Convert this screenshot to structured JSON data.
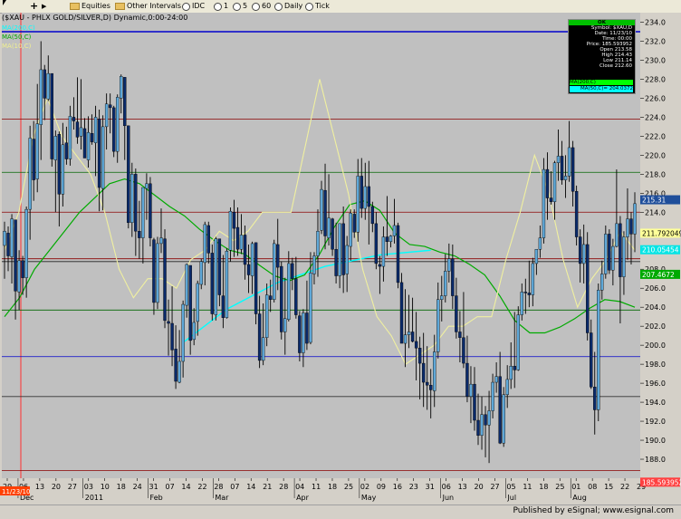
{
  "toolbar": {
    "items": [
      {
        "icon": "folder-icon",
        "label": "Equities"
      },
      {
        "icon": "folder-icon",
        "label": "Other Intervals"
      },
      {
        "icon": "gear-icon",
        "label": "IDC"
      },
      {
        "label": "1"
      },
      {
        "label": "5"
      },
      {
        "label": "60"
      },
      {
        "label": "Daily"
      },
      {
        "label": "Tick"
      }
    ]
  },
  "footer": {
    "published_text": "Published by eSignal; www.esignal.com"
  },
  "info_box": {
    "status": "OK",
    "rows": [
      "Symbol: $XAU,D",
      "Date: 11/23/10",
      "Time: 00:00",
      "Price: 185.593952",
      "Open 213.58",
      "High 214.43",
      "Low 211.14",
      "Close 212.60"
    ],
    "ma1": "MA(200,C)",
    "ma2": "MA(50,C)= 204.0372"
  },
  "chart_data": {
    "type": "candlestick",
    "title": "($XAU - PHLX GOLD/SILVER,D) Dynamic,0:00-24:00",
    "ylim": [
      186.0,
      235.0
    ],
    "y_ticks": [
      188,
      190,
      192,
      194,
      196,
      198,
      200,
      202,
      204,
      206,
      208,
      210,
      212,
      214,
      216,
      218,
      220,
      222,
      224,
      226,
      228,
      230,
      232,
      234
    ],
    "x_ticks": [
      "29",
      "06",
      "13",
      "20",
      "27",
      "03",
      "10",
      "18",
      "24",
      "31",
      "07",
      "14",
      "22",
      "28",
      "07",
      "14",
      "21",
      "28",
      "04",
      "11",
      "18",
      "25",
      "02",
      "09",
      "16",
      "23",
      "31",
      "06",
      "13",
      "20",
      "27",
      "05",
      "11",
      "18",
      "25",
      "01",
      "08",
      "15",
      "22",
      "29"
    ],
    "month_labels": [
      "Dec",
      "2011",
      "Feb",
      "Mar",
      "Apr",
      "May",
      "Jun",
      "Jul",
      "Aug"
    ],
    "legend": [
      {
        "label": "MA(200,C)",
        "color": "#00ffff"
      },
      {
        "label": "MA(50,C)",
        "color": "#00aa00"
      },
      {
        "label": "MA(10,C)",
        "color": "#ffff99"
      }
    ],
    "price_tags": [
      {
        "value": 215.31,
        "label": "215.31",
        "bg": "#1f4e9a",
        "fg": "#ffffff"
      },
      {
        "value": 211.79,
        "label": "211.792049",
        "bg": "#ffff99",
        "fg": "#000000"
      },
      {
        "value": 210.05,
        "label": "210.05454",
        "bg": "#00e5e5",
        "fg": "#ffffff"
      },
      {
        "value": 207.46,
        "label": "207.4672",
        "bg": "#00aa00",
        "fg": "#ffffff"
      },
      {
        "value": 185.59,
        "label": "185.593952",
        "bg": "#ff4040",
        "fg": "#ffffff"
      }
    ],
    "bottom_left_tag": "11/23/10",
    "horizontal_lines": [
      {
        "value": 233.0,
        "color": "#0000cc",
        "lineWidth": 1.5
      },
      {
        "value": 223.8,
        "color": "#8b0000"
      },
      {
        "value": 218.2,
        "color": "#006600"
      },
      {
        "value": 214.0,
        "color": "#8b0000"
      },
      {
        "value": 209.1,
        "color": "#8b0000"
      },
      {
        "value": 208.8,
        "color": "#222222"
      },
      {
        "value": 203.7,
        "color": "#006600"
      },
      {
        "value": 198.8,
        "color": "#0000cc"
      },
      {
        "value": 194.6,
        "color": "#333333"
      },
      {
        "value": 186.8,
        "color": "#8b0000"
      }
    ],
    "ma50": [
      203,
      205,
      208,
      210,
      212,
      214,
      215.5,
      217,
      217.5,
      217,
      215.8,
      214.6,
      213.6,
      212.2,
      211,
      210,
      209.6,
      208.4,
      207.3,
      206.8,
      207.4,
      209.6,
      212.5,
      214.8,
      215.2,
      214.2,
      211.8,
      210.6,
      210.4,
      209.8,
      209.4,
      208.5,
      207.4,
      205.2,
      202.6,
      201.3,
      201.3,
      201.9,
      202.8,
      203.9,
      204.8,
      204.6,
      204.0
    ],
    "ma10": [
      210,
      214,
      222,
      226,
      222,
      220,
      218,
      214,
      208,
      205,
      207,
      207,
      206,
      209,
      210,
      212,
      211,
      212,
      214,
      214,
      214,
      221,
      228,
      222,
      216,
      208,
      203,
      201,
      198,
      199,
      200,
      202,
      202,
      203,
      203,
      209,
      214,
      220,
      216,
      209,
      204,
      207,
      209,
      212,
      210
    ],
    "ma200": [
      [
        48.7,
        200.2
      ],
      [
        61,
        203.8
      ],
      [
        75,
        206.6
      ],
      [
        88,
        208.3
      ],
      [
        103,
        209.5
      ],
      [
        117,
        210.0
      ]
    ],
    "candles": [
      [
        210.5,
        213,
        207,
        212
      ],
      [
        211.8,
        212.5,
        207.8,
        209.4
      ],
      [
        209.3,
        213.8,
        206.5,
        213.3
      ],
      [
        213.2,
        213.2,
        202.7,
        205.7
      ],
      [
        205.6,
        210,
        203.7,
        208.9
      ],
      [
        208.9,
        209.4,
        205.3,
        207.1
      ],
      [
        207.1,
        214.6,
        205,
        214.3
      ],
      [
        214.3,
        223.1,
        211.1,
        221.8
      ],
      [
        221.7,
        223.6,
        215.2,
        217.4
      ],
      [
        217.5,
        227.5,
        216.1,
        223.3
      ],
      [
        223.2,
        232,
        219.5,
        229
      ],
      [
        229,
        229.5,
        223.7,
        226
      ],
      [
        225.9,
        230.5,
        225.7,
        228.6
      ],
      [
        228.6,
        228.6,
        218.8,
        219.6
      ],
      [
        219.5,
        222.6,
        214,
        222
      ],
      [
        222.2,
        222.5,
        212.5,
        215.9
      ],
      [
        215.9,
        223.4,
        214.6,
        221.1
      ],
      [
        221.3,
        223,
        219,
        219.6
      ],
      [
        219.6,
        225.2,
        218.9,
        224.1
      ],
      [
        224,
        226.1,
        222.7,
        223.6
      ],
      [
        223.5,
        228.2,
        221.2,
        221.9
      ],
      [
        222,
        228,
        220.6,
        222.9
      ],
      [
        222.8,
        223.9,
        219.7,
        219.7
      ],
      [
        219.5,
        224.1,
        218.7,
        222.4
      ],
      [
        222.3,
        224.3,
        221.1,
        221.4
      ],
      [
        221.3,
        225.2,
        217.8,
        224
      ],
      [
        223.8,
        224.8,
        214.1,
        216.6
      ],
      [
        216.5,
        224.2,
        214.2,
        223
      ],
      [
        223,
        226.5,
        220.6,
        225.4
      ],
      [
        225.3,
        226.5,
        222.3,
        225
      ],
      [
        225,
        225.2,
        219.8,
        220.4
      ],
      [
        220.4,
        226.4,
        219.2,
        226.1
      ],
      [
        226,
        228.5,
        224.4,
        228.3
      ],
      [
        228.2,
        228.2,
        219.5,
        223.1
      ],
      [
        223.1,
        223.1,
        212.3,
        212.9
      ],
      [
        212.9,
        219.2,
        211.4,
        218
      ],
      [
        218,
        218.6,
        209.4,
        212
      ],
      [
        212,
        215.2,
        209.1,
        211.3
      ],
      [
        211.3,
        216.6,
        208.6,
        216.6
      ],
      [
        216.5,
        218.1,
        213.2,
        217
      ],
      [
        217,
        217.7,
        210.4,
        211.3
      ],
      [
        211.1,
        211.3,
        203.2,
        204.5
      ],
      [
        204.5,
        211.4,
        203.8,
        210.7
      ],
      [
        210.7,
        214.4,
        209.7,
        211.3
      ],
      [
        211.2,
        212.2,
        201.8,
        202.6
      ],
      [
        202.5,
        204.8,
        198.9,
        202.3
      ],
      [
        202.3,
        206.2,
        197.8,
        199.5
      ],
      [
        199.6,
        202.1,
        195.4,
        196.2
      ],
      [
        196.1,
        201.6,
        196,
        198.3
      ],
      [
        198.3,
        204.7,
        196.6,
        204.3
      ],
      [
        204.2,
        208.6,
        202.9,
        208.5
      ],
      [
        208.4,
        208.4,
        199,
        200.5
      ],
      [
        200.6,
        203.9,
        200,
        202.4
      ],
      [
        202.5,
        206.8,
        201,
        206.5
      ],
      [
        206.4,
        209.1,
        205.9,
        208.8
      ],
      [
        208.7,
        213,
        206.3,
        212.7
      ],
      [
        212.6,
        213,
        208.6,
        209.7
      ],
      [
        209.7,
        210.6,
        202.6,
        203.3
      ],
      [
        203.2,
        211.4,
        202.6,
        211.2
      ],
      [
        211.2,
        211.2,
        204.1,
        205.3
      ],
      [
        205.2,
        209.5,
        201.8,
        202.9
      ],
      [
        202.9,
        210.2,
        202.8,
        209.9
      ],
      [
        210,
        214.5,
        208.8,
        214.1
      ],
      [
        214,
        215.3,
        209.3,
        212.3
      ],
      [
        212.4,
        214.5,
        209.4,
        210.1
      ],
      [
        210.1,
        213.8,
        209.6,
        211.6
      ],
      [
        211.6,
        212.6,
        206.9,
        208.5
      ],
      [
        208.5,
        210.6,
        205.5,
        207.4
      ],
      [
        207.3,
        210.9,
        205.4,
        210.7
      ],
      [
        210.8,
        210.8,
        202.2,
        203.3
      ],
      [
        203.3,
        205.2,
        197.6,
        198.4
      ],
      [
        198.4,
        204.4,
        197.9,
        200.8
      ],
      [
        200.8,
        206.5,
        199.9,
        205.3
      ],
      [
        205.2,
        206.9,
        203.5,
        204.8
      ],
      [
        204.8,
        211.1,
        204.5,
        210.7
      ],
      [
        210.6,
        213.3,
        205.8,
        208.2
      ],
      [
        208.3,
        208.8,
        200.6,
        201.4
      ],
      [
        201.4,
        207.1,
        199,
        202.8
      ],
      [
        202.7,
        209.9,
        202.5,
        208.6
      ],
      [
        208.6,
        209.2,
        205.8,
        207
      ],
      [
        207,
        209.3,
        202.8,
        203.2
      ],
      [
        203.1,
        203.6,
        198.3,
        199.2
      ],
      [
        199.2,
        203.8,
        197.7,
        203.4
      ],
      [
        203.4,
        206.8,
        199.5,
        200.2
      ],
      [
        200.3,
        209.8,
        200.1,
        207.6
      ],
      [
        207.5,
        209.8,
        206.4,
        209.4
      ],
      [
        209.4,
        214.3,
        207.2,
        212
      ],
      [
        212.1,
        217.3,
        211.7,
        216.4
      ],
      [
        216.3,
        219.1,
        210.1,
        211.5
      ],
      [
        211.3,
        218,
        210.5,
        213.4
      ],
      [
        213.3,
        213.4,
        209.4,
        210.1
      ],
      [
        210.1,
        212.9,
        206.5,
        207.3
      ],
      [
        207.3,
        212.8,
        206,
        212.8
      ],
      [
        212.8,
        214.6,
        205.5,
        207.4
      ],
      [
        207.5,
        211.5,
        205.6,
        210.5
      ],
      [
        210.4,
        214.3,
        208.9,
        213.9
      ],
      [
        213.8,
        214.3,
        211.3,
        211.9
      ],
      [
        211.9,
        219.6,
        210.9,
        217.8
      ],
      [
        217.8,
        219.7,
        213.4,
        214.4
      ],
      [
        214.4,
        219.2,
        213.2,
        216.7
      ],
      [
        216.7,
        219.4,
        210.6,
        214.6
      ],
      [
        214.6,
        215.1,
        211.9,
        212.8
      ],
      [
        212.8,
        214,
        208,
        208.6
      ],
      [
        208.5,
        209.4,
        205.4,
        208.3
      ],
      [
        208.3,
        212.5,
        206.7,
        211.4
      ],
      [
        211.4,
        215.7,
        209.4,
        210.9
      ],
      [
        210.9,
        211.6,
        210.3,
        211.5
      ],
      [
        211.5,
        215.4,
        210.7,
        212.6
      ],
      [
        212.6,
        212.9,
        206,
        206.6
      ],
      [
        206.6,
        207.6,
        200.2,
        200.2
      ],
      [
        200.2,
        205.9,
        197.7,
        201.1
      ],
      [
        201.1,
        205.3,
        199.7,
        201.4
      ],
      [
        201.4,
        205,
        200.3,
        200.4
      ],
      [
        200.4,
        203.5,
        196.3,
        199.7
      ],
      [
        199.7,
        200.9,
        194.3,
        198.1
      ],
      [
        198.1,
        201.3,
        193.5,
        196.1
      ],
      [
        196.1,
        199.9,
        193.2,
        195.8
      ],
      [
        195.8,
        197.5,
        192.3,
        195.3
      ],
      [
        195.2,
        201.1,
        193.5,
        199.3
      ],
      [
        199.3,
        206.6,
        198.6,
        204.8
      ],
      [
        204.8,
        207.3,
        202.5,
        205.2
      ],
      [
        205.2,
        209.6,
        204.5,
        207.8
      ],
      [
        207.8,
        210.7,
        206.6,
        209.1
      ],
      [
        209.1,
        210.6,
        203.8,
        205.2
      ],
      [
        205.2,
        207.1,
        200.7,
        201.4
      ],
      [
        201.4,
        203.6,
        198.2,
        200.8
      ],
      [
        200.8,
        205.6,
        197.6,
        198.1
      ],
      [
        198.1,
        201,
        194,
        194.6
      ],
      [
        194.6,
        197.8,
        191.8,
        195.9
      ],
      [
        195.9,
        197.7,
        191,
        192.1
      ],
      [
        192.1,
        194.9,
        189.5,
        190.5
      ],
      [
        190.5,
        194.6,
        189,
        192.7
      ],
      [
        192.7,
        193.6,
        188.2,
        191.6
      ],
      [
        191.6,
        195.2,
        187.6,
        193.1
      ],
      [
        193.1,
        197,
        192.3,
        196.1
      ],
      [
        196.1,
        198.2,
        195,
        196.7
      ],
      [
        196.7,
        199.3,
        189.6,
        189.7
      ],
      [
        189.7,
        195.6,
        189.3,
        194.8
      ],
      [
        194.8,
        197.9,
        193.4,
        196.4
      ],
      [
        196.4,
        200.3,
        195.4,
        197.8
      ],
      [
        197.8,
        203.5,
        195.5,
        197.4
      ],
      [
        197.4,
        204.1,
        197.3,
        203.2
      ],
      [
        203.2,
        206.5,
        202.6,
        205.6
      ],
      [
        205.6,
        207,
        203.3,
        205.5
      ],
      [
        205.5,
        208.9,
        204,
        205.3
      ],
      [
        205.3,
        209.2,
        204.1,
        208.6
      ],
      [
        208.6,
        210.1,
        207.4,
        210.1
      ],
      [
        210.1,
        212.6,
        209.2,
        211.3
      ],
      [
        211.3,
        219.7,
        210.7,
        218.5
      ],
      [
        218.5,
        220.3,
        213.2,
        215.5
      ],
      [
        215.5,
        218.3,
        214.8,
        215.1
      ],
      [
        215.1,
        219.4,
        213.2,
        219.2
      ],
      [
        219.2,
        222.7,
        217.3,
        219.9
      ],
      [
        219.9,
        221.5,
        216.9,
        217.4
      ],
      [
        217.4,
        220,
        215.5,
        217.8
      ],
      [
        217.8,
        223.6,
        217.2,
        220.8
      ],
      [
        220.8,
        221.5,
        214.6,
        216.2
      ],
      [
        216.2,
        216.8,
        210.5,
        211.4
      ],
      [
        211.4,
        212.2,
        206.6,
        208.6
      ],
      [
        208.6,
        212.7,
        206.5,
        210.6
      ],
      [
        210.6,
        211.9,
        200.5,
        201.3
      ],
      [
        201.3,
        202.7,
        195.4,
        195.6
      ],
      [
        195.6,
        199.3,
        190.6,
        193.2
      ],
      [
        193.2,
        206.5,
        192,
        205.8
      ],
      [
        205.8,
        208.9,
        204.8,
        207.5
      ],
      [
        207.5,
        212.6,
        207,
        211.7
      ],
      [
        211.7,
        212.2,
        207.5,
        207.9
      ],
      [
        207.9,
        211.2,
        206.3,
        210.4
      ],
      [
        210.4,
        218.5,
        210.3,
        212.8
      ],
      [
        212.8,
        213.6,
        202.3,
        207.2
      ],
      [
        207.2,
        212,
        205.3,
        211.4
      ],
      [
        211.4,
        216.5,
        209,
        213.3
      ],
      [
        213.3,
        214,
        208.5,
        211.7
      ],
      [
        211.7,
        216.1,
        209.8,
        214.9
      ]
    ]
  }
}
